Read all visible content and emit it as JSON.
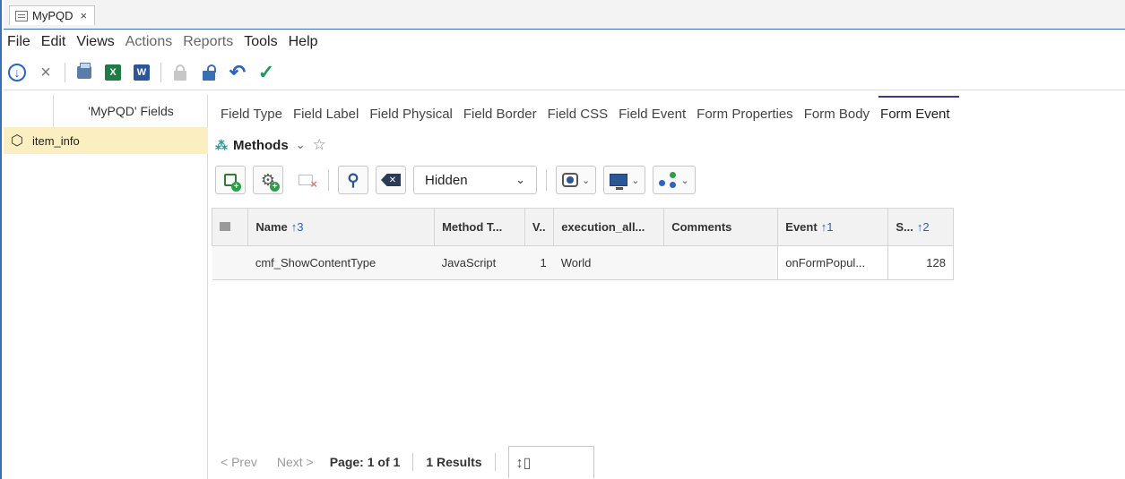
{
  "window": {
    "tab_title": "MyPQD",
    "tab_close": "×"
  },
  "menu": [
    "File",
    "Edit",
    "Views",
    "Actions",
    "Reports",
    "Tools",
    "Help"
  ],
  "toolbar": {
    "excel_glyph": "X",
    "word_glyph": "W"
  },
  "left_panel": {
    "header": "'MyPQD' Fields",
    "items": [
      {
        "label": "item_info",
        "selected": true
      }
    ]
  },
  "tabs": [
    {
      "label": "Field Type",
      "active": false
    },
    {
      "label": "Field Label",
      "active": false
    },
    {
      "label": "Field Physical",
      "active": false
    },
    {
      "label": "Field Border",
      "active": false
    },
    {
      "label": "Field CSS",
      "active": false
    },
    {
      "label": "Field Event",
      "active": false
    },
    {
      "label": "Form Properties",
      "active": false
    },
    {
      "label": "Form Body",
      "active": false
    },
    {
      "label": "Form Event",
      "active": true
    }
  ],
  "methods": {
    "label": "Methods"
  },
  "gridbar": {
    "filter_value": "Hidden"
  },
  "grid": {
    "columns": [
      {
        "label": "",
        "sort": ""
      },
      {
        "label": "Name",
        "sort": "↑3"
      },
      {
        "label": "Method T...",
        "sort": ""
      },
      {
        "label": "V..",
        "sort": ""
      },
      {
        "label": "execution_all...",
        "sort": ""
      },
      {
        "label": "Comments",
        "sort": ""
      },
      {
        "label": "Event",
        "sort": "↑1"
      },
      {
        "label": "S...",
        "sort": "↑2"
      }
    ],
    "rows": [
      {
        "name": "cmf_ShowContentType",
        "method_type": "JavaScript",
        "v": "1",
        "execution": "World",
        "comments": "",
        "event": "onFormPopul...",
        "s": "128"
      }
    ]
  },
  "pager": {
    "prev": "< Prev",
    "next": "Next >",
    "page": "Page: 1 of 1",
    "results": "1 Results"
  },
  "colors": {
    "accent": "#3a6fb5",
    "selected_row": "#fbefc2",
    "active_tab_line": "#3a3a8c"
  }
}
